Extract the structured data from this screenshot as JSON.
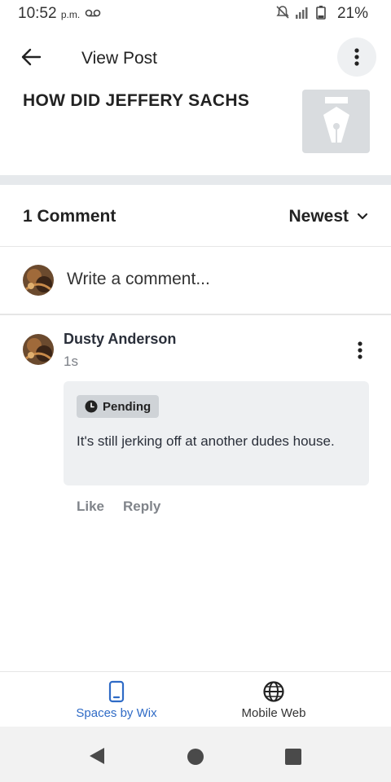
{
  "status_bar": {
    "time": "10:52",
    "ampm": "p.m.",
    "battery": "21%"
  },
  "header": {
    "title": "View Post"
  },
  "post": {
    "title": "HOW DID JEFFERY SACHS"
  },
  "comments": {
    "count_label": "1 Comment",
    "sort_label": "Newest"
  },
  "composer": {
    "placeholder": "Write a comment..."
  },
  "comment": {
    "author": "Dusty Anderson",
    "age": "1s",
    "status": "Pending",
    "text": "It's still jerking off at another dudes house.",
    "actions": {
      "like": "Like",
      "reply": "Reply"
    }
  },
  "bottom_nav": {
    "items": [
      {
        "label": "Spaces by Wix",
        "icon": "phone-icon",
        "active": true
      },
      {
        "label": "Mobile Web",
        "icon": "globe-icon",
        "active": false
      }
    ]
  },
  "colors": {
    "accent": "#2f6bc6",
    "bubble": "#eef0f2",
    "divider": "#e6e9ec"
  }
}
